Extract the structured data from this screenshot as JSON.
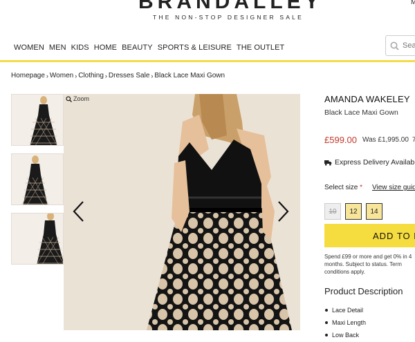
{
  "header": {
    "logo_text": "BRANDALLEY",
    "tagline": "THE NON-STOP DESIGNER SALE",
    "corner_letter": "M"
  },
  "nav": {
    "items": [
      "WOMEN",
      "MEN",
      "KIDS",
      "HOME",
      "BEAUTY",
      "SPORTS & LEISURE",
      "THE OUTLET"
    ]
  },
  "search": {
    "placeholder": "Sea"
  },
  "breadcrumb": {
    "items": [
      "Homepage",
      "Women",
      "Clothing",
      "Dresses Sale",
      "Black Lace Maxi Gown"
    ]
  },
  "gallery": {
    "zoom_label": "Zoom"
  },
  "product": {
    "brand": "AMANDA WAKELEY",
    "name": "Black Lace Maxi Gown",
    "price_now": "£599.00",
    "price_was": "Was £1,995.00",
    "price_extra": "7",
    "delivery": "Express Delivery Availab",
    "size_label": "Select size",
    "size_required_mark": "*",
    "size_guide": "View size guid",
    "sizes": [
      {
        "label": "10",
        "available": false
      },
      {
        "label": "12",
        "available": true
      },
      {
        "label": "14",
        "available": true
      }
    ],
    "add_button": "ADD TO B",
    "finance_text": "Spend £99 or more and get 0% in 4 months. Subject to status. Term conditions apply.",
    "description_title": "Product Description",
    "description_items": [
      "Lace Detail",
      "Maxi Length",
      "Low Back"
    ]
  },
  "colors": {
    "accent_yellow": "#f5dc3f",
    "price_red": "#c0392b"
  }
}
